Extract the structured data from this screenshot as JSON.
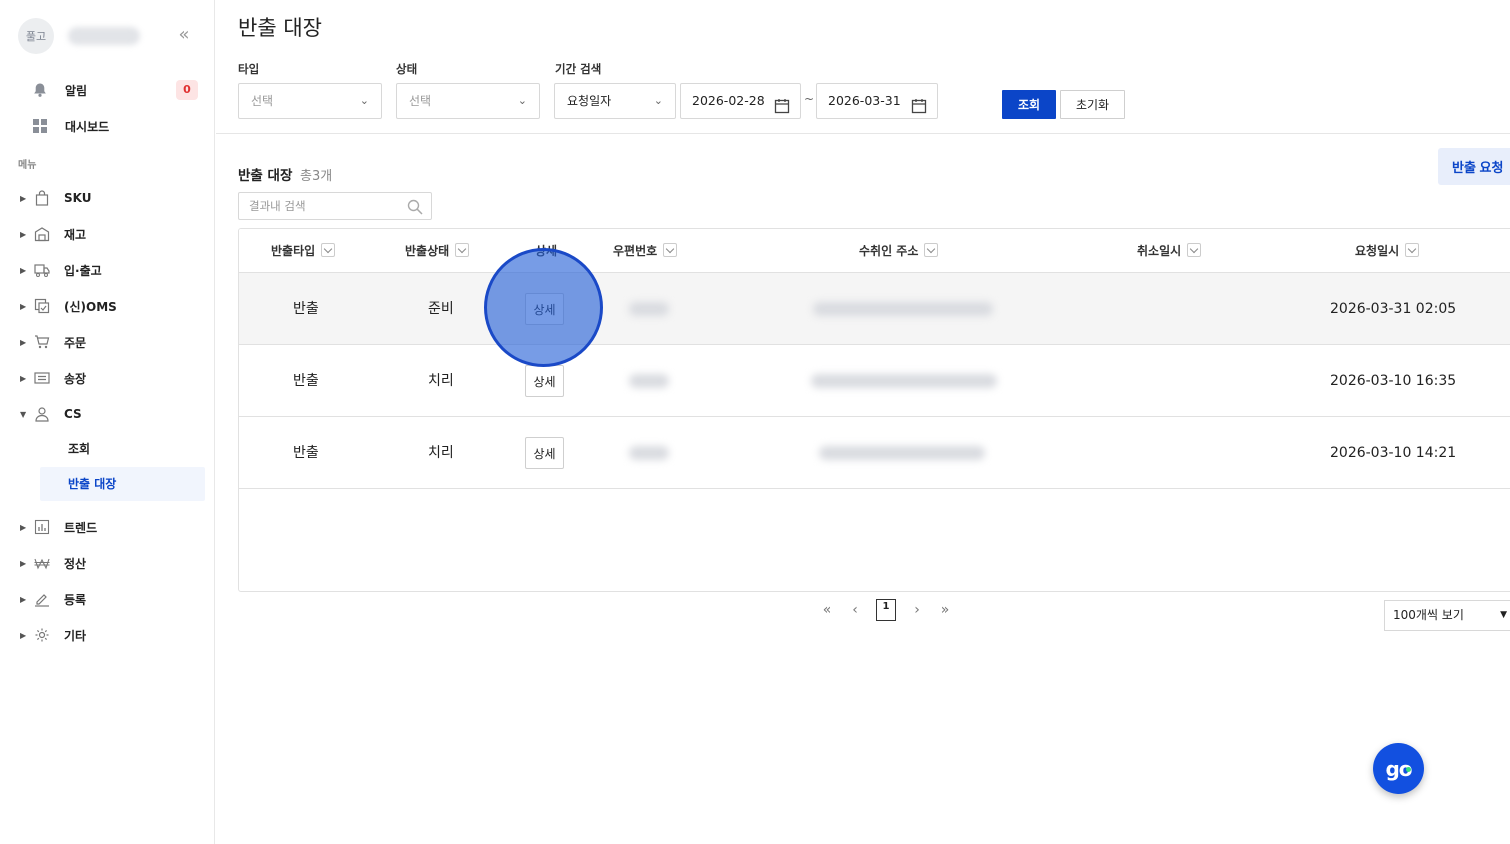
{
  "sidebar": {
    "avatar_text": "풀고",
    "collapse_icon": "double-chevron-left-icon",
    "alerts": {
      "label": "알림",
      "count": "0",
      "icon": "bell-icon"
    },
    "dashboard": {
      "label": "대시보드",
      "icon": "grid-icon"
    },
    "menu_caption": "메뉴",
    "items": [
      {
        "label": "SKU",
        "icon": "bag-icon"
      },
      {
        "label": "재고",
        "icon": "warehouse-icon"
      },
      {
        "label": "입·출고",
        "icon": "truck-icon"
      },
      {
        "label": "(신)OMS",
        "icon": "oms-icon"
      },
      {
        "label": "주문",
        "icon": "cart-icon"
      },
      {
        "label": "송장",
        "icon": "invoice-icon"
      },
      {
        "label": "CS",
        "icon": "person-icon",
        "expanded": true
      },
      {
        "label": "트렌드",
        "icon": "bar-chart-icon"
      },
      {
        "label": "정산",
        "icon": "won-icon"
      },
      {
        "label": "등록",
        "icon": "pencil-icon"
      },
      {
        "label": "기타",
        "icon": "gear-icon"
      }
    ],
    "cs_sub": [
      {
        "label": "조회",
        "active": false
      },
      {
        "label": "반출 대장",
        "active": true
      }
    ]
  },
  "page": {
    "title": "반출 대장"
  },
  "filters": {
    "type": {
      "label": "타입",
      "placeholder": "선택"
    },
    "status": {
      "label": "상태",
      "placeholder": "선택"
    },
    "period": {
      "label": "기간 검색",
      "basis": "요청일자",
      "start": "2026-02-28",
      "end": "2026-03-31",
      "separator": "~"
    },
    "search_button": "조회",
    "reset_button": "초기화"
  },
  "list": {
    "title": "반출 대장",
    "count_text": "총3개",
    "request_button": "반출 요청",
    "search_placeholder": "결과내 검색",
    "columns": [
      "반출타입",
      "반출상태",
      "상세",
      "우편번호",
      "수취인 주소",
      "취소일시",
      "요청일시"
    ],
    "rows": [
      {
        "type": "반출",
        "status": "준비",
        "detail": "상세",
        "requested_at": "2026-03-31 02:05"
      },
      {
        "type": "반출",
        "status": "치리",
        "detail": "상세",
        "requested_at": "2026-03-10 16:35"
      },
      {
        "type": "반출",
        "status": "치리",
        "detail": "상세",
        "requested_at": "2026-03-10 14:21"
      }
    ]
  },
  "pagination": {
    "current": "1",
    "page_size": "100개씩 보기"
  },
  "fab": {
    "label": "go",
    "icon": "go-chat-icon"
  },
  "colors": {
    "primary": "#0b45c8",
    "badge_bg": "#fde4e4",
    "badge_text": "#e03030",
    "active_bg": "#f1f5fd"
  }
}
